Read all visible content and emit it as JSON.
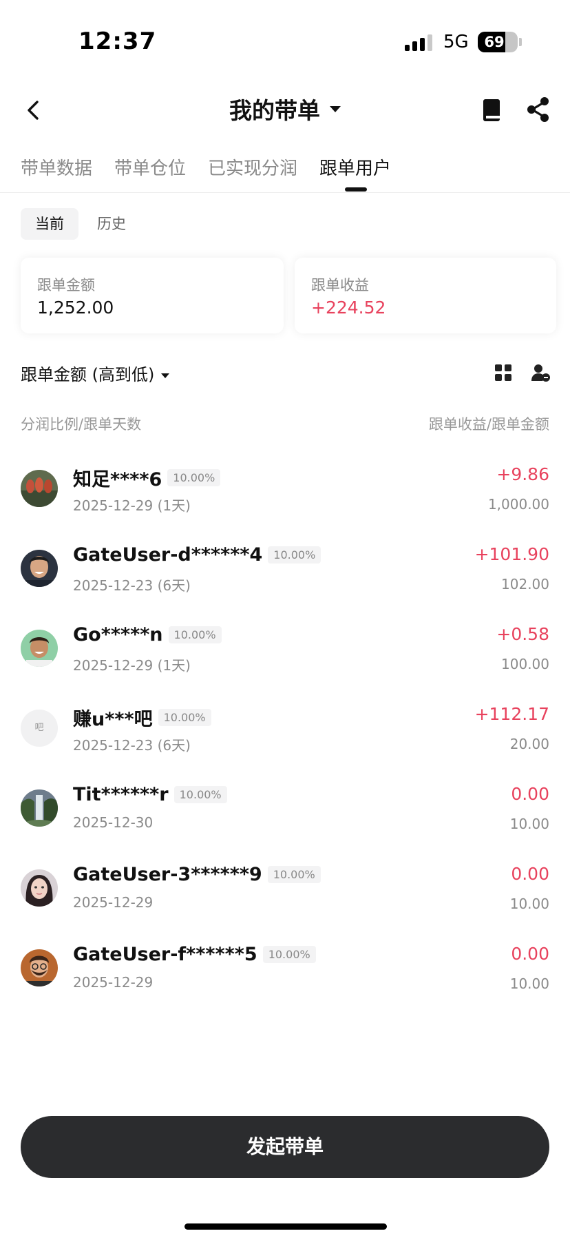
{
  "status_bar": {
    "time": "12:37",
    "network": "5G",
    "battery": "69",
    "battery_fraction": 0.69
  },
  "header": {
    "title": "我的带单",
    "icons": [
      "back-icon",
      "chevron-down-icon",
      "book-icon",
      "share-icon"
    ]
  },
  "tabs": [
    {
      "label": "带单数据",
      "active": false
    },
    {
      "label": "带单仓位",
      "active": false
    },
    {
      "label": "已实现分润",
      "active": false
    },
    {
      "label": "跟单用户",
      "active": true
    }
  ],
  "segment": {
    "current": "当前",
    "history": "历史"
  },
  "summary": {
    "amount_label": "跟单金额",
    "amount_value": "1,252.00",
    "profit_label": "跟单收益",
    "profit_value": "+224.52"
  },
  "sort": {
    "label": "跟单金额 (高到低)",
    "icons": [
      "grid-icon",
      "user-filter-icon"
    ]
  },
  "columns": {
    "left": "分润比例/跟单天数",
    "right": "跟单收益/跟单金额"
  },
  "users": [
    {
      "name": "知足****6",
      "ratio": "10.00%",
      "date": "2025-12-29 (1天)",
      "profit": "+9.86",
      "amount": "1,000.00",
      "avatar": "photo"
    },
    {
      "name": "GateUser-d******4",
      "ratio": "10.00%",
      "date": "2025-12-23 (6天)",
      "profit": "+101.90",
      "amount": "102.00",
      "avatar": "photo"
    },
    {
      "name": "Go*****n",
      "ratio": "10.00%",
      "date": "2025-12-29 (1天)",
      "profit": "+0.58",
      "amount": "100.00",
      "avatar": "photo"
    },
    {
      "name": "赚u***吧",
      "ratio": "10.00%",
      "date": "2025-12-23 (6天)",
      "profit": "+112.17",
      "amount": "20.00",
      "avatar": "initial",
      "initial": "吧"
    },
    {
      "name": "Tit******r",
      "ratio": "10.00%",
      "date": "2025-12-30",
      "profit": "0.00",
      "amount": "10.00",
      "avatar": "photo"
    },
    {
      "name": "GateUser-3******9",
      "ratio": "10.00%",
      "date": "2025-12-29",
      "profit": "0.00",
      "amount": "10.00",
      "avatar": "photo"
    },
    {
      "name": "GateUser-f******5",
      "ratio": "10.00%",
      "date": "2025-12-29",
      "profit": "0.00",
      "amount": "10.00",
      "avatar": "photo"
    }
  ],
  "cta": {
    "label": "发起带单"
  },
  "colors": {
    "profit_red": "#e8425d",
    "cta_bg": "#2b2c2e",
    "muted_text": "#8a8a8a"
  }
}
